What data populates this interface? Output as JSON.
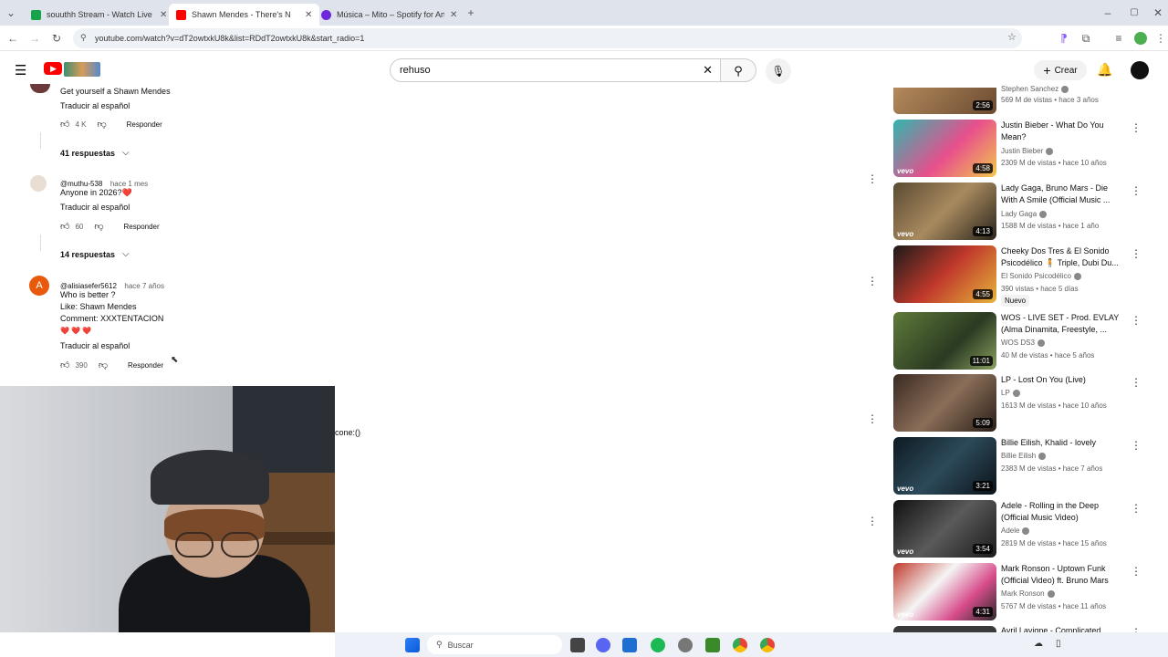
{
  "browser": {
    "tabs": [
      {
        "title": "souuthh Stream - Watch Live o",
        "color": "#16a34a"
      },
      {
        "title": "Shawn Mendes - There's N",
        "color": "#ff0000"
      },
      {
        "title": "Música – Mito – Spotify for Art",
        "color": "#6d28d9"
      }
    ],
    "url": "youtube.com/watch?v=dT2owtxkU8k&list=RDdT2owtxkU8k&start_radio=1"
  },
  "youtube": {
    "search_value": "rehuso",
    "create_label": "Crear"
  },
  "comments": [
    {
      "text": "Get yourself a Shawn Mendes",
      "translate": "Traducir al español",
      "likes": "4 K",
      "reply": "Responder"
    },
    {
      "replies": "41 respuestas"
    },
    {
      "author": "@muthu-538",
      "time": "hace 1 mes",
      "text": "Anyone in 2026?❤️",
      "translate": "Traducir al español",
      "likes": "60",
      "reply": "Responder"
    },
    {
      "replies": "14 respuestas"
    },
    {
      "author": "@alisiasefer5612",
      "time": "hace 7 años",
      "lines": [
        "Who is better ?",
        "Like: Shawn Mendes",
        "Comment: XXXTENTACION",
        "❤️ ❤️ ❤️"
      ],
      "translate": "Traducir al español",
      "likes": "390",
      "reply": "Responder"
    }
  ],
  "middle_text": "cone:()",
  "sidebar": [
    {
      "title": "",
      "channel": "Stephen Sanchez",
      "meta": "569 M de vistas • hace 3 años",
      "duration": "2:56"
    },
    {
      "title": "Justin Bieber - What Do You Mean?",
      "channel": "Justin Bieber",
      "meta": "2309 M de vistas • hace 10 años",
      "duration": "4:58"
    },
    {
      "title": "Lady Gaga, Bruno Mars - Die With A Smile (Official Music ...",
      "channel": "Lady Gaga",
      "meta": "1588 M de vistas • hace 1 año",
      "duration": "4:13"
    },
    {
      "title": "Cheeky Dos Tres & El Sonido Psicodélico 🧍 Triple, Dubi Du...",
      "channel": "El Sonido Psicodélico",
      "meta": "390 vistas • hace 5 días",
      "badge": "Nuevo",
      "duration": "4:55"
    },
    {
      "title": "WOS - LIVE SET - Prod. EVLAY (Alma Dinamita, Freestyle, ...",
      "channel": "WOS DS3",
      "meta": "40 M de vistas • hace 5 años",
      "duration": "11:01"
    },
    {
      "title": "LP - Lost On You (Live)",
      "channel": "LP",
      "meta": "1613 M de vistas • hace 10 años",
      "duration": "5:09"
    },
    {
      "title": "Billie Eilish, Khalid - lovely",
      "channel": "Billie Eilish",
      "meta": "2383 M de vistas • hace 7 años",
      "duration": "3:21"
    },
    {
      "title": "Adele - Rolling in the Deep (Official Music Video)",
      "channel": "Adele",
      "meta": "2819 M de vistas • hace 15 años",
      "duration": "3:54"
    },
    {
      "title": "Mark Ronson - Uptown Funk (Official Video) ft. Bruno Mars",
      "channel": "Mark Ronson",
      "meta": "5767 M de vistas • hace 11 años",
      "duration": "4:31"
    },
    {
      "title": "Avril Lavigne - Complicated",
      "channel": "",
      "meta": "",
      "duration": ""
    }
  ],
  "taskbar": {
    "search_placeholder": "Buscar"
  }
}
